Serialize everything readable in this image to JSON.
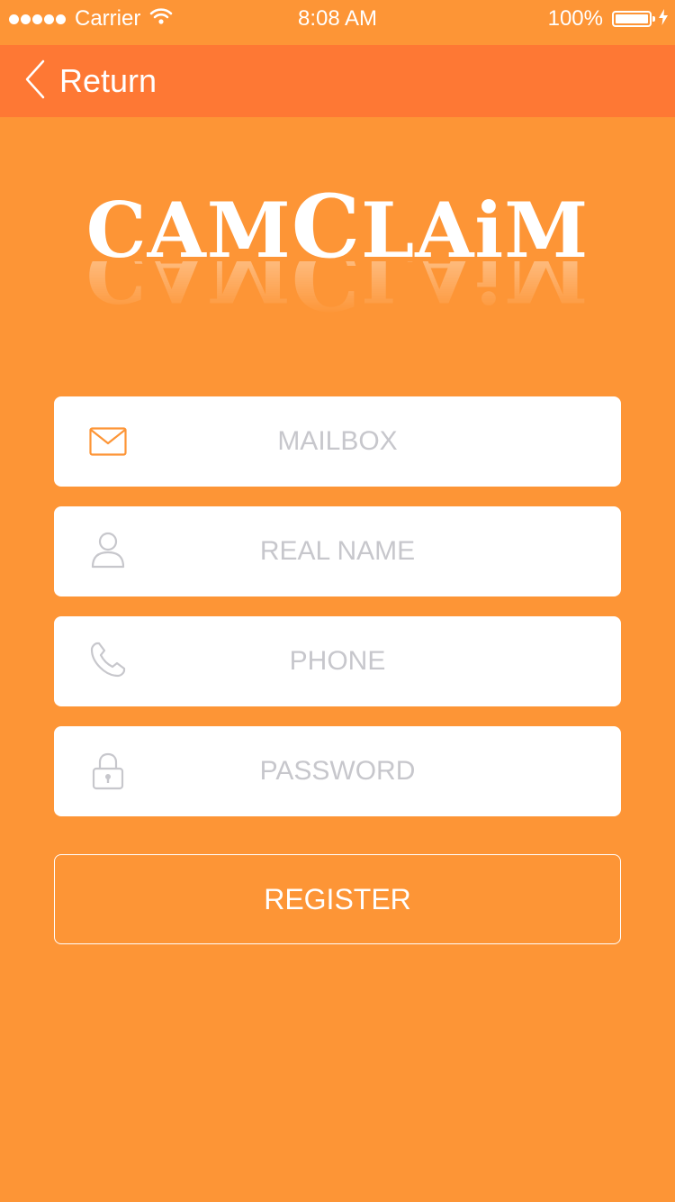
{
  "status_bar": {
    "carrier": "Carrier",
    "time": "8:08 AM",
    "battery": "100%"
  },
  "nav": {
    "back_label": "Return"
  },
  "logo": {
    "part1": "CAM",
    "part2": "C",
    "part3": "LAiM"
  },
  "form": {
    "mailbox_placeholder": "MAILBOX",
    "realname_placeholder": "REAL NAME",
    "phone_placeholder": "PHONE",
    "password_placeholder": "PASSWORD",
    "register_label": "REGISTER"
  },
  "colors": {
    "background": "#FD9536",
    "nav_bar": "#FE7834",
    "mail_icon": "#FD9536",
    "field_icon": "#C7C7CC"
  },
  "icons": {
    "mailbox": "envelope-icon",
    "realname": "user-icon",
    "phone": "phone-icon",
    "password": "lock-icon",
    "back": "chevron-left-icon"
  }
}
